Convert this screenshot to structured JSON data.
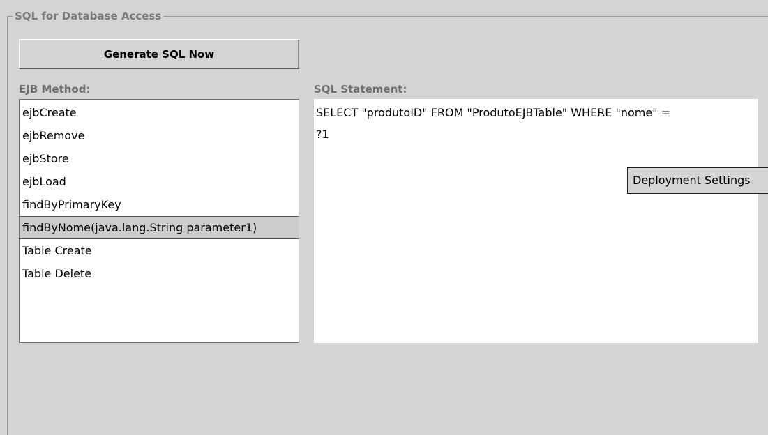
{
  "panel": {
    "title": "SQL for Database Access"
  },
  "generate_button": {
    "mnemonic": "G",
    "label_rest": "enerate SQL Now"
  },
  "ejb_method": {
    "label": "EJB Method:",
    "items": [
      "ejbCreate",
      "ejbRemove",
      "ejbStore",
      "ejbLoad",
      "findByPrimaryKey",
      "findByNome(java.lang.String parameter1)",
      "Table Create",
      "Table Delete"
    ],
    "selected": "findByNome(java.lang.String parameter1)"
  },
  "sql_statement": {
    "label": "SQL Statement:",
    "text": "SELECT \"produtoID\" FROM \"ProdutoEJBTable\" WHERE \"nome\" =\n?1"
  },
  "tooltip": {
    "text": "Deployment Settings"
  }
}
